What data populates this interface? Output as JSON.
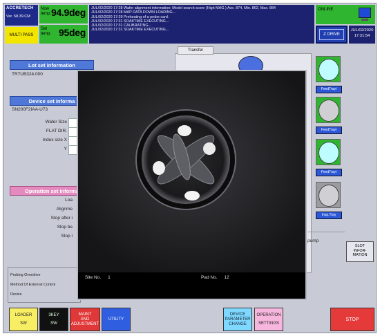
{
  "header": {
    "brand": "ACCRETECH",
    "version": "Ver. 58.39.CM",
    "multipass": "MULTI PASS",
    "temp_now_label": "Now temp.",
    "temp_now_value": "94.9deg",
    "temp_set_label": "Set temp.",
    "temp_set_value": "95deg",
    "log": [
      "JUL/02/2020 17:28 Wafer alignment information: Model search score (High MAG.) Ave. 874, Min. 862, Max. 884",
      "JUL/02/2020 17:28 MAP DATA DOWN LOADING...",
      "JUL/02/2020 17:29 Preheating of a probe card.",
      "JUL/02/2020 17:31 SOAKTIME EXECUTING...",
      "JUL/02/2020 17:31 CALIBRATING...",
      "JUL/02/2020 17:31 SOAKTIME EXECUTING..."
    ],
    "online": "ONLINE",
    "zdrive": "Z DRIVE",
    "date": "JUL/02/2020",
    "time": "17:31:54"
  },
  "lot": {
    "title": "Lot set information",
    "value": "TR7UB324.000"
  },
  "device": {
    "title": "Device set informa",
    "value": "SN200F2IAA-U73",
    "wafer_size": "Wafer Size",
    "flat_dir": "FLAT DIR.",
    "index_x": "Index size X",
    "index_y": "Y"
  },
  "operation": {
    "title": "Operation set informa",
    "load": "Loa",
    "alignment": "Alignme",
    "stop_after": "Stop after i",
    "stop_be": "Stop be",
    "stop": "Stop i"
  },
  "desc": {
    "line1": "Probing Overdrive",
    "line2": "Method Of External Control",
    "line3": "Device"
  },
  "transfer": {
    "tab": "Transfer",
    "pump": "pump",
    "slot_info": [
      "SLOT",
      "INFOR-",
      "MATION"
    ],
    "slot_labels": [
      "FeedTrayi",
      "FeedTrayi",
      "FeedTrayi",
      "Insp.Tray"
    ]
  },
  "camera": {
    "site_label": "Site No.",
    "site_value": "1",
    "pad_label": "Pad No.",
    "pad_value": "12"
  },
  "buttons": {
    "loader": [
      "LOADER",
      "SW"
    ],
    "key3": [
      "3KEY",
      "SW"
    ],
    "maint": [
      "MAINT",
      "AND",
      "ADJUSTMENT"
    ],
    "utility": "UTILITY",
    "device": [
      "DEVICE",
      "PARAMETER",
      "CHANGE"
    ],
    "operation": [
      "OPERATION",
      "SETTINGS"
    ],
    "stop": "STOP"
  },
  "colors": {
    "green": "#2fb52f",
    "navy": "#1d2270",
    "blue_title": "#4f78d8",
    "pink_title": "#e48abf",
    "stop_red": "#e53a3a"
  }
}
